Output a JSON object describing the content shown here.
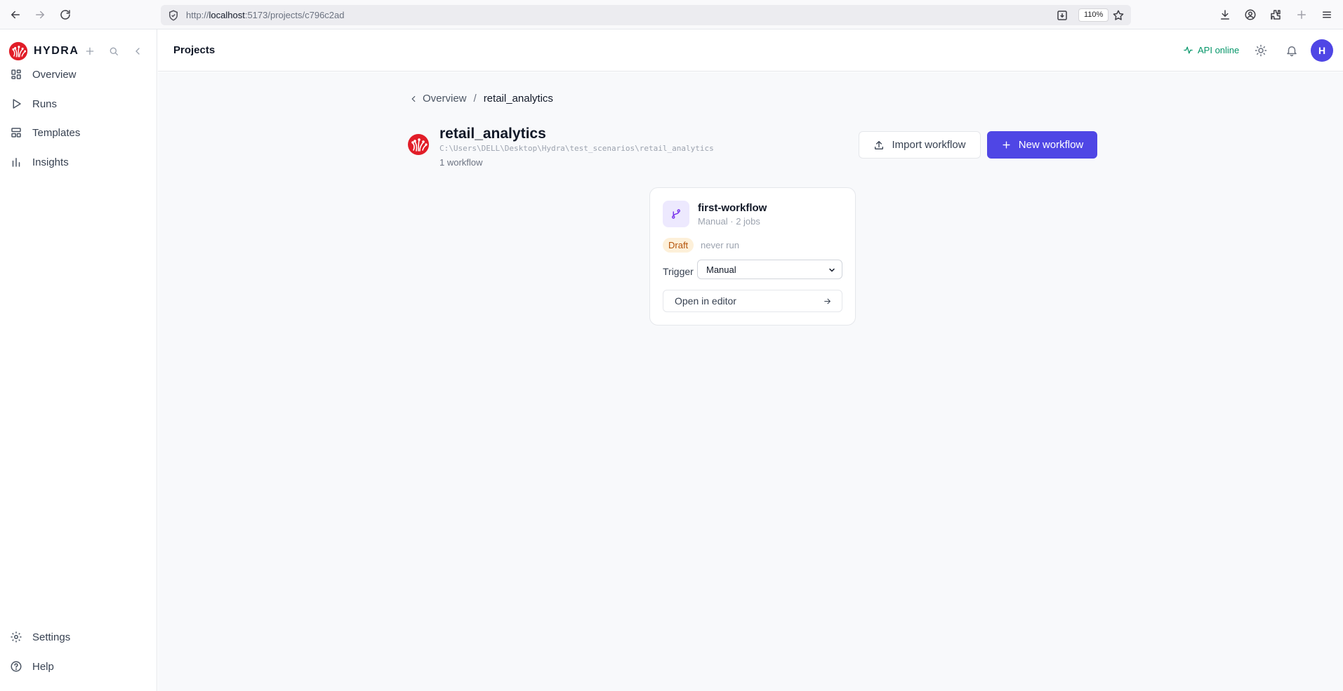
{
  "browser": {
    "url_prefix": "http://",
    "url_host": "localhost",
    "url_rest": ":5173/projects/c796c2ad",
    "zoom": "110%"
  },
  "sidebar": {
    "brand": "HYDRA",
    "items": [
      {
        "label": "Overview",
        "icon": "layout-grid-icon"
      },
      {
        "label": "Runs",
        "icon": "play-icon"
      },
      {
        "label": "Templates",
        "icon": "templates-icon"
      },
      {
        "label": "Insights",
        "icon": "bar-chart-icon"
      }
    ],
    "footer": [
      {
        "label": "Settings",
        "icon": "gear-icon"
      },
      {
        "label": "Help",
        "icon": "help-circle-icon"
      }
    ]
  },
  "topbar": {
    "title": "Projects",
    "api_status": "API online",
    "avatar_initial": "H"
  },
  "breadcrumb": {
    "back": "Overview",
    "separator": "/",
    "current": "retail_analytics"
  },
  "project": {
    "name": "retail_analytics",
    "path": "C:\\Users\\DELL\\Desktop\\Hydra\\test_scenarios\\retail_analytics",
    "workflow_count": "1 workflow"
  },
  "actions": {
    "import_label": "Import workflow",
    "new_label": "New workflow"
  },
  "workflow": {
    "name": "first-workflow",
    "meta": "Manual · 2 jobs",
    "status": "Draft",
    "last_run": "never run",
    "trigger_label": "Trigger",
    "trigger_value": "Manual",
    "open_label": "Open in editor"
  },
  "colors": {
    "accent": "#4f46e5",
    "api_online": "#059669",
    "draft_bg": "#fdf0d9",
    "draft_text": "#b45309",
    "brand_red": "#e11d28"
  }
}
